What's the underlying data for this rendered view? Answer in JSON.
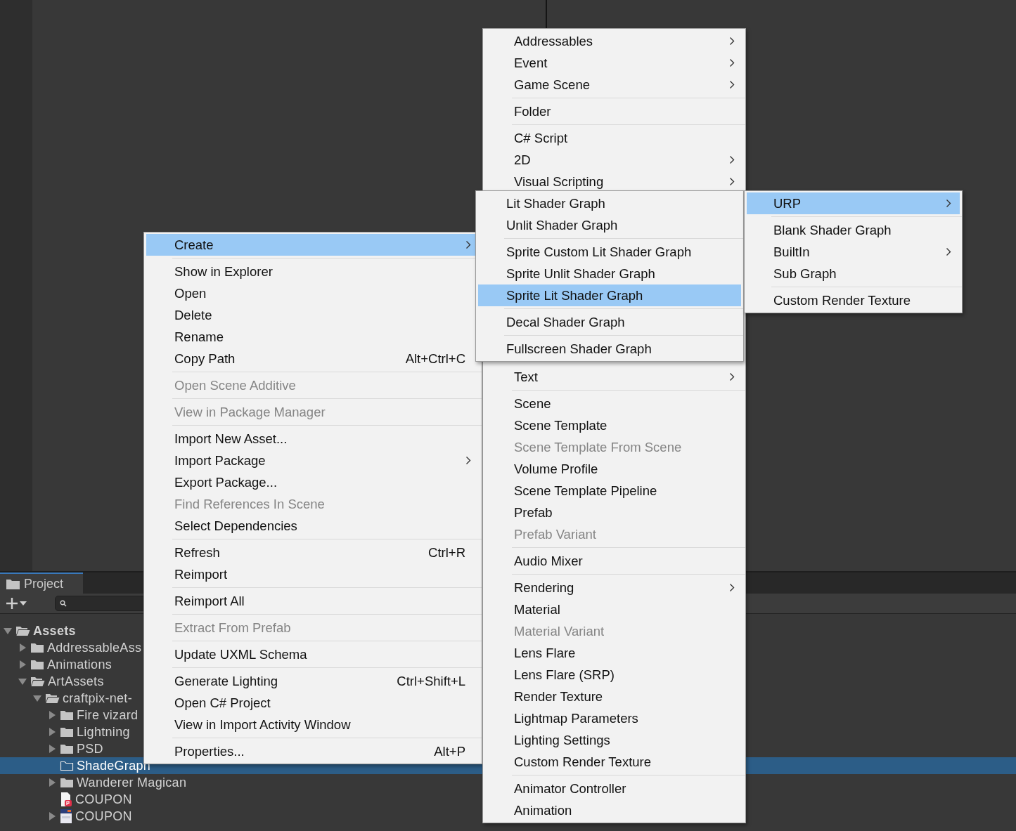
{
  "project_panel": {
    "tab": {
      "label": "Project",
      "selected": true
    },
    "tree": [
      {
        "label": "Assets",
        "kind": "folder",
        "expanded": true,
        "selected": false,
        "children": [
          {
            "label": "AddressableAss",
            "kind": "folder",
            "expanded": false,
            "selected": false
          },
          {
            "label": "Animations",
            "kind": "folder",
            "expanded": false,
            "selected": false
          },
          {
            "label": "ArtAssets",
            "kind": "folder",
            "expanded": true,
            "selected": false,
            "children": [
              {
                "label": "craftpix-net-",
                "kind": "folder",
                "expanded": true,
                "selected": false,
                "children": [
                  {
                    "label": "Fire vizard",
                    "kind": "folder",
                    "expanded": false,
                    "selected": false
                  },
                  {
                    "label": "Lightning",
                    "kind": "folder",
                    "expanded": false,
                    "selected": false
                  },
                  {
                    "label": "PSD",
                    "kind": "folder",
                    "expanded": false,
                    "selected": false
                  },
                  {
                    "label": "ShadeGraph",
                    "kind": "empty-folder",
                    "selected": true
                  },
                  {
                    "label": "Wanderer Magican",
                    "kind": "folder",
                    "expanded": false,
                    "selected": false
                  },
                  {
                    "label": "COUPON",
                    "kind": "pdf",
                    "selected": false
                  },
                  {
                    "label": "COUPON",
                    "kind": "image",
                    "expanded": false,
                    "selected": false
                  }
                ]
              }
            ]
          }
        ]
      }
    ]
  },
  "main_menu": {
    "items": [
      {
        "kind": "item",
        "label": "Create",
        "submenu": true,
        "selected": true,
        "disabled": false
      },
      {
        "kind": "separator"
      },
      {
        "kind": "item",
        "label": "Show in Explorer",
        "selected": false,
        "disabled": false
      },
      {
        "kind": "item",
        "label": "Open",
        "selected": false,
        "disabled": false
      },
      {
        "kind": "item",
        "label": "Delete",
        "selected": false,
        "disabled": false
      },
      {
        "kind": "item",
        "label": "Rename",
        "selected": false,
        "disabled": false
      },
      {
        "kind": "item",
        "label": "Copy Path",
        "shortcut": "Alt+Ctrl+C",
        "selected": false,
        "disabled": false
      },
      {
        "kind": "separator"
      },
      {
        "kind": "item",
        "label": "Open Scene Additive",
        "selected": false,
        "disabled": true
      },
      {
        "kind": "separator"
      },
      {
        "kind": "item",
        "label": "View in Package Manager",
        "selected": false,
        "disabled": true
      },
      {
        "kind": "separator"
      },
      {
        "kind": "item",
        "label": "Import New Asset...",
        "selected": false,
        "disabled": false
      },
      {
        "kind": "item",
        "label": "Import Package",
        "submenu": true,
        "selected": false,
        "disabled": false
      },
      {
        "kind": "item",
        "label": "Export Package...",
        "selected": false,
        "disabled": false
      },
      {
        "kind": "item",
        "label": "Find References In Scene",
        "selected": false,
        "disabled": true
      },
      {
        "kind": "item",
        "label": "Select Dependencies",
        "selected": false,
        "disabled": false
      },
      {
        "kind": "separator"
      },
      {
        "kind": "item",
        "label": "Refresh",
        "shortcut": "Ctrl+R",
        "selected": false,
        "disabled": false
      },
      {
        "kind": "item",
        "label": "Reimport",
        "selected": false,
        "disabled": false
      },
      {
        "kind": "separator"
      },
      {
        "kind": "item",
        "label": "Reimport All",
        "selected": false,
        "disabled": false
      },
      {
        "kind": "separator"
      },
      {
        "kind": "item",
        "label": "Extract From Prefab",
        "selected": false,
        "disabled": true
      },
      {
        "kind": "separator"
      },
      {
        "kind": "item",
        "label": "Update UXML Schema",
        "selected": false,
        "disabled": false
      },
      {
        "kind": "separator"
      },
      {
        "kind": "item",
        "label": "Generate Lighting",
        "shortcut": "Ctrl+Shift+L",
        "selected": false,
        "disabled": false
      },
      {
        "kind": "item",
        "label": "Open C# Project",
        "selected": false,
        "disabled": false
      },
      {
        "kind": "item",
        "label": "View in Import Activity Window",
        "selected": false,
        "disabled": false
      },
      {
        "kind": "separator"
      },
      {
        "kind": "item",
        "label": "Properties...",
        "shortcut": "Alt+P",
        "selected": false,
        "disabled": false
      }
    ]
  },
  "create_menu": {
    "items": [
      {
        "kind": "item",
        "label": "Addressables",
        "submenu": true,
        "selected": false,
        "disabled": false
      },
      {
        "kind": "item",
        "label": "Event",
        "submenu": true,
        "selected": false,
        "disabled": false
      },
      {
        "kind": "item",
        "label": "Game Scene",
        "submenu": true,
        "selected": false,
        "disabled": false
      },
      {
        "kind": "separator"
      },
      {
        "kind": "item",
        "label": "Folder",
        "selected": false,
        "disabled": false
      },
      {
        "kind": "separator"
      },
      {
        "kind": "item",
        "label": "C# Script",
        "selected": false,
        "disabled": false
      },
      {
        "kind": "item",
        "label": "2D",
        "submenu": true,
        "selected": false,
        "disabled": false
      },
      {
        "kind": "item",
        "label": "Visual Scripting",
        "submenu": true,
        "selected": false,
        "disabled": false
      }
    ],
    "items_after_submenu": [
      {
        "kind": "item",
        "label": "Text",
        "submenu": true,
        "selected": false,
        "disabled": false
      },
      {
        "kind": "separator"
      },
      {
        "kind": "item",
        "label": "Scene",
        "selected": false,
        "disabled": false
      },
      {
        "kind": "item",
        "label": "Scene Template",
        "selected": false,
        "disabled": false
      },
      {
        "kind": "item",
        "label": "Scene Template From Scene",
        "selected": false,
        "disabled": true
      },
      {
        "kind": "item",
        "label": "Volume Profile",
        "selected": false,
        "disabled": false
      },
      {
        "kind": "item",
        "label": "Scene Template Pipeline",
        "selected": false,
        "disabled": false
      },
      {
        "kind": "item",
        "label": "Prefab",
        "selected": false,
        "disabled": false
      },
      {
        "kind": "item",
        "label": "Prefab Variant",
        "selected": false,
        "disabled": true
      },
      {
        "kind": "separator"
      },
      {
        "kind": "item",
        "label": "Audio Mixer",
        "selected": false,
        "disabled": false
      },
      {
        "kind": "separator"
      },
      {
        "kind": "item",
        "label": "Rendering",
        "submenu": true,
        "selected": false,
        "disabled": false
      },
      {
        "kind": "item",
        "label": "Material",
        "selected": false,
        "disabled": false
      },
      {
        "kind": "item",
        "label": "Material Variant",
        "selected": false,
        "disabled": true
      },
      {
        "kind": "item",
        "label": "Lens Flare",
        "selected": false,
        "disabled": false
      },
      {
        "kind": "item",
        "label": "Lens Flare (SRP)",
        "selected": false,
        "disabled": false
      },
      {
        "kind": "item",
        "label": "Render Texture",
        "selected": false,
        "disabled": false
      },
      {
        "kind": "item",
        "label": "Lightmap Parameters",
        "selected": false,
        "disabled": false
      },
      {
        "kind": "item",
        "label": "Lighting Settings",
        "selected": false,
        "disabled": false
      },
      {
        "kind": "item",
        "label": "Custom Render Texture",
        "selected": false,
        "disabled": false
      },
      {
        "kind": "separator"
      },
      {
        "kind": "item",
        "label": "Animator Controller",
        "selected": false,
        "disabled": false
      },
      {
        "kind": "item",
        "label": "Animation",
        "selected": false,
        "disabled": false
      }
    ]
  },
  "shader_graph_submenu": {
    "items": [
      {
        "kind": "item",
        "label": "Lit Shader Graph",
        "selected": false,
        "disabled": false
      },
      {
        "kind": "item",
        "label": "Unlit Shader Graph",
        "selected": false,
        "disabled": false
      },
      {
        "kind": "separator"
      },
      {
        "kind": "item",
        "label": "Sprite Custom Lit Shader Graph",
        "selected": false,
        "disabled": false
      },
      {
        "kind": "item",
        "label": "Sprite Unlit Shader Graph",
        "selected": false,
        "disabled": false
      },
      {
        "kind": "item",
        "label": "Sprite Lit Shader Graph",
        "selected": true,
        "disabled": false
      },
      {
        "kind": "separator"
      },
      {
        "kind": "item",
        "label": "Decal Shader Graph",
        "selected": false,
        "disabled": false
      },
      {
        "kind": "separator"
      },
      {
        "kind": "item",
        "label": "Fullscreen Shader Graph",
        "selected": false,
        "disabled": false
      }
    ]
  },
  "urp_submenu": {
    "items": [
      {
        "kind": "item",
        "label": "URP",
        "submenu": true,
        "selected": true,
        "disabled": false
      },
      {
        "kind": "separator"
      },
      {
        "kind": "item",
        "label": "Blank Shader Graph",
        "selected": false,
        "disabled": false
      },
      {
        "kind": "item",
        "label": "BuiltIn",
        "submenu": true,
        "selected": false,
        "disabled": false
      },
      {
        "kind": "item",
        "label": "Sub Graph",
        "selected": false,
        "disabled": false
      },
      {
        "kind": "separator"
      },
      {
        "kind": "item",
        "label": "Custom Render Texture",
        "selected": false,
        "disabled": false
      }
    ]
  }
}
